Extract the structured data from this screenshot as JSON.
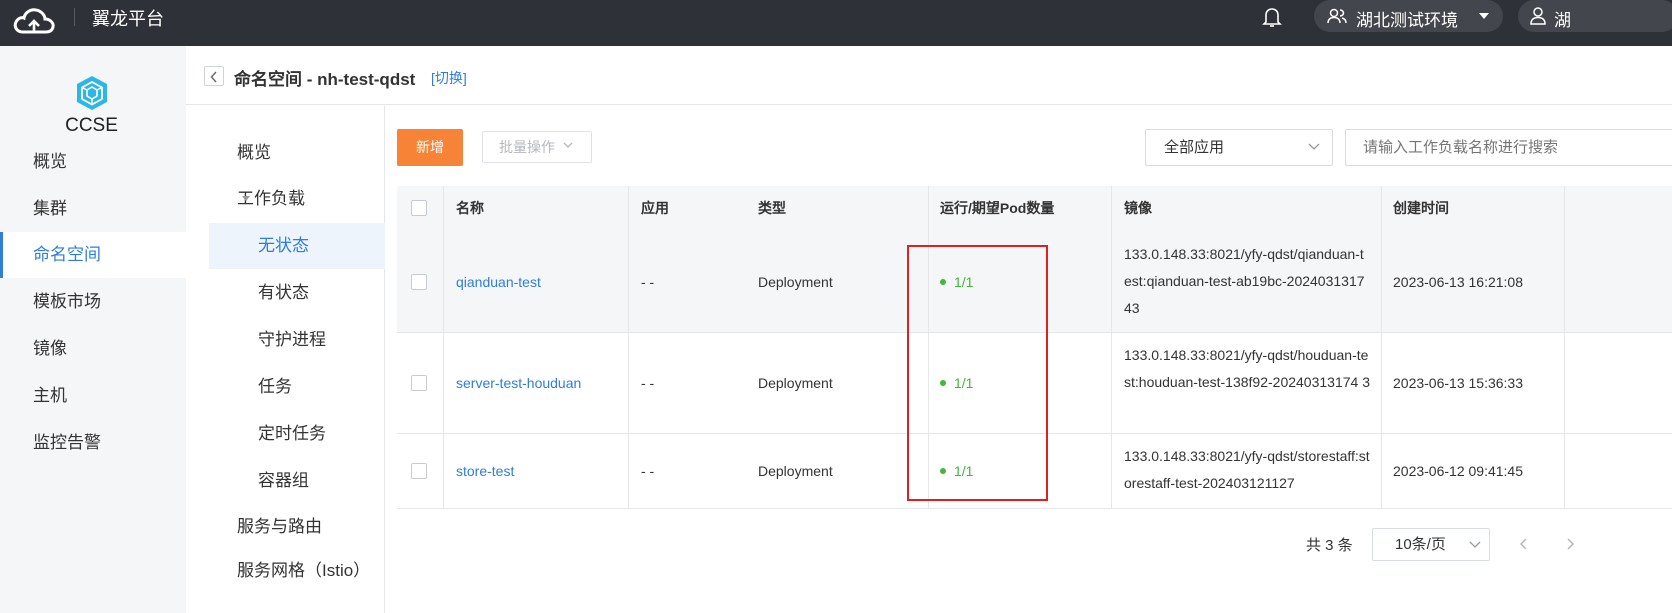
{
  "topbar": {
    "brand": "翼龙平台",
    "environment": "湖北测试环境",
    "user": "湖"
  },
  "sidebar": {
    "product": "CCSE",
    "items": [
      {
        "label": "概览"
      },
      {
        "label": "集群"
      },
      {
        "label": "命名空间",
        "active": true
      },
      {
        "label": "模板市场"
      },
      {
        "label": "镜像"
      },
      {
        "label": "主机"
      },
      {
        "label": "监控告警"
      }
    ]
  },
  "header": {
    "title": "命名空间 - nh-test-qdst",
    "switch_label": "[切换]"
  },
  "subnav": {
    "overview": "概览",
    "workload": "工作负载",
    "workload_items": [
      "无状态",
      "有状态",
      "守护进程",
      "任务",
      "定时任务",
      "容器组"
    ],
    "service_route": "服务与路由",
    "service_mesh": "服务网格（Istio）"
  },
  "toolbar": {
    "add_label": "新增",
    "batch_label": "批量操作",
    "app_filter": "全部应用",
    "search_placeholder": "请输入工作负载名称进行搜索"
  },
  "table": {
    "columns": [
      "名称",
      "应用",
      "类型",
      "运行/期望Pod数量",
      "镜像",
      "创建时间"
    ],
    "rows": [
      {
        "name": "qianduan-test",
        "app": "- -",
        "type": "Deployment",
        "pods": "1/1",
        "image": "133.0.148.33:8021/yfy-qdst/qianduan-test:qianduan-test-ab19bc-2024031317 43",
        "created": "2023-06-13 16:21:08"
      },
      {
        "name": "server-test-houduan",
        "app": "- -",
        "type": "Deployment",
        "pods": "1/1",
        "image": "133.0.148.33:8021/yfy-qdst/houduan-test:houduan-test-138f92-20240313174 3",
        "created": "2023-06-13 15:36:33"
      },
      {
        "name": "store-test",
        "app": "- -",
        "type": "Deployment",
        "pods": "1/1",
        "image": "133.0.148.33:8021/yfy-qdst/storestaff:storestaff-test-202403121127",
        "created": "2023-06-12 09:41:45"
      }
    ]
  },
  "pagination": {
    "total": "共 3 条",
    "page_size": "10条/页"
  },
  "colors": {
    "topbar": "#2e3137",
    "accent": "#2f7ed8",
    "primary_button": "#f78336",
    "status_running": "#41b836",
    "highlight": "#e02020"
  }
}
